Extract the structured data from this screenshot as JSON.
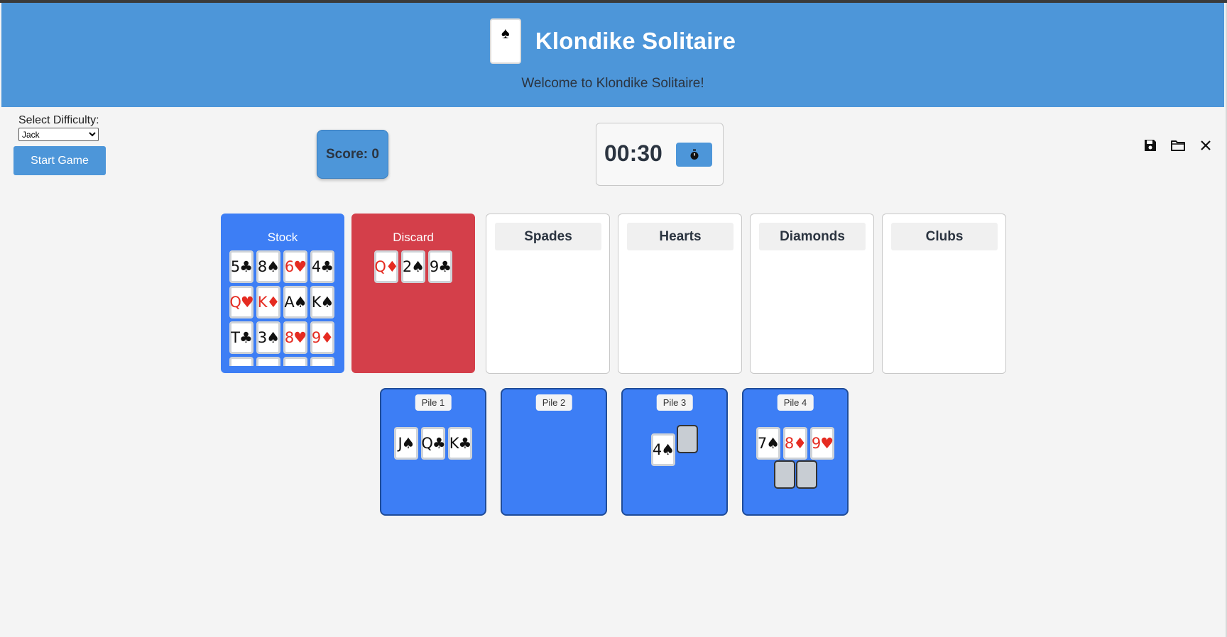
{
  "header": {
    "logo_suit": "♠",
    "title": "Klondike Solitaire",
    "welcome": "Welcome to Klondike Solitaire!"
  },
  "controls": {
    "difficulty_label": "Select Difficulty:",
    "difficulty_selected": "Jack",
    "start_label": "Start Game",
    "score": "Score: 0",
    "timer": "00:30"
  },
  "toolbar": {
    "save_icon": "floppy-disk",
    "open_icon": "folder",
    "close_icon": "x"
  },
  "stock": {
    "title": "Stock",
    "cards": [
      {
        "label": "5♣",
        "red": false
      },
      {
        "label": "8♠",
        "red": false
      },
      {
        "label": "6♥",
        "red": true
      },
      {
        "label": "4♣",
        "red": false
      },
      {
        "label": "Q♥",
        "red": true
      },
      {
        "label": "K♦",
        "red": true
      },
      {
        "label": "A♠",
        "red": false
      },
      {
        "label": "K♠",
        "red": false
      },
      {
        "label": "T♣",
        "red": false
      },
      {
        "label": "3♠",
        "red": false
      },
      {
        "label": "8♥",
        "red": true
      },
      {
        "label": "9♦",
        "red": true
      },
      {
        "label": "",
        "red": false
      },
      {
        "label": "",
        "red": false
      },
      {
        "label": "",
        "red": false
      },
      {
        "label": "",
        "red": false
      }
    ]
  },
  "discard": {
    "title": "Discard",
    "cards": [
      {
        "label": "Q♦",
        "red": true
      },
      {
        "label": "2♠",
        "red": false
      },
      {
        "label": "9♣",
        "red": false
      }
    ]
  },
  "foundations": [
    "Spades",
    "Hearts",
    "Diamonds",
    "Clubs"
  ],
  "piles": [
    {
      "label": "Pile 1",
      "cards": [
        {
          "label": "J♠",
          "red": false
        },
        {
          "label": "Q♣",
          "red": false
        },
        {
          "label": "K♣",
          "red": false
        }
      ],
      "facedown": 0
    },
    {
      "label": "Pile 2",
      "cards": [],
      "facedown": 0
    },
    {
      "label": "Pile 3",
      "cards": [
        {
          "label": "4♠",
          "red": false
        }
      ],
      "facedown": 1
    },
    {
      "label": "Pile 4",
      "cards": [
        {
          "label": "7♠",
          "red": false
        },
        {
          "label": "8♦",
          "red": true
        },
        {
          "label": "9♥",
          "red": true
        }
      ],
      "facedown": 2
    }
  ],
  "colors": {
    "header": "#4d96d9",
    "stock": "#3d7ef5",
    "discard": "#d43f4a",
    "red_suit": "#e52b21"
  }
}
